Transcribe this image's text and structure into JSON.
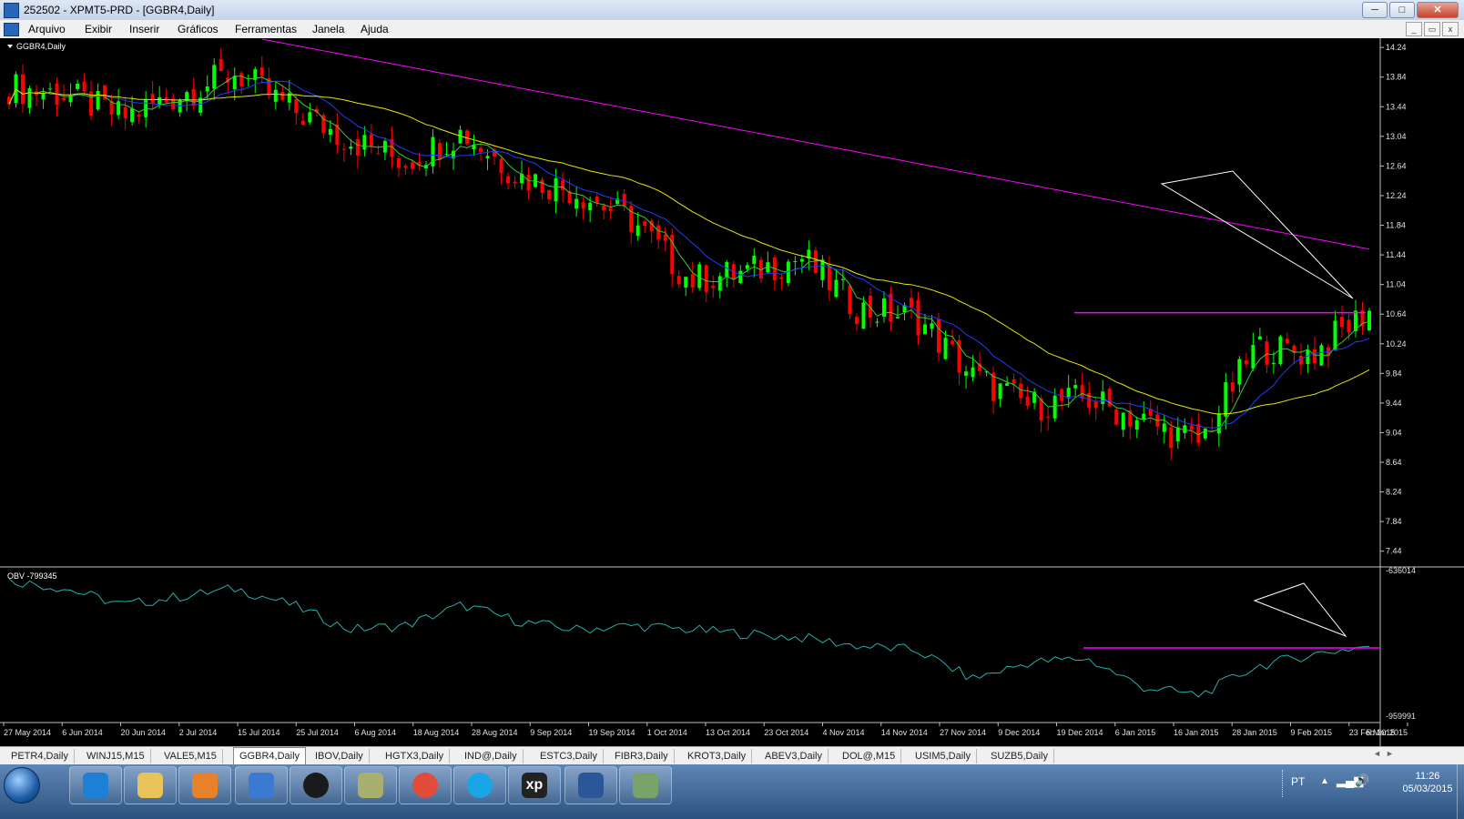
{
  "window": {
    "title": "252502 - XPMT5-PRD - [GGBR4,Daily]",
    "buttons": [
      "─",
      "□",
      "✕"
    ]
  },
  "menu": {
    "items": [
      "Arquivo",
      "Exibir",
      "Inserir",
      "Gráficos",
      "Ferramentas",
      "Janela",
      "Ajuda"
    ]
  },
  "mdi_buttons": [
    "_",
    "▭",
    "x"
  ],
  "chart": {
    "symbol_label": "GGBR4,Daily",
    "price_ticks": [
      "14.24",
      "13.84",
      "13.44",
      "13.04",
      "12.64",
      "12.24",
      "11.84",
      "11.44",
      "11.04",
      "10.64",
      "10.24",
      "9.84",
      "9.44",
      "9.04",
      "8.64",
      "8.24",
      "7.84",
      "7.44"
    ],
    "obv_label": "OBV -799345",
    "obv_ticks": [
      "-636014",
      "-959991"
    ],
    "date_labels": [
      "27 May 2014",
      "6 Jun 2014",
      "20 Jun 2014",
      "2 Jul 2014",
      "15 Jul 2014",
      "25 Jul 2014",
      "6 Aug 2014",
      "18 Aug 2014",
      "28 Aug 2014",
      "9 Sep 2014",
      "19 Sep 2014",
      "1 Oct 2014",
      "13 Oct 2014",
      "23 Oct 2014",
      "4 Nov 2014",
      "14 Nov 2014",
      "27 Nov 2014",
      "9 Dec 2014",
      "19 Dec 2014",
      "6 Jan 2015",
      "16 Jan 2015",
      "28 Jan 2015",
      "9 Feb 2015",
      "23 Feb 2015",
      "5 Mar 2015"
    ],
    "colors": {
      "bull": "#00ff00",
      "bear": "#ff0000",
      "ma_fast": "#32cd32",
      "ma_mid": "#1e3cff",
      "ma_slow": "#e6e600",
      "ma_long": "#ff00ff",
      "obv_line": "#20b2aa",
      "resistance": "#ff00ff",
      "triangle": "#ffffff"
    }
  },
  "chart_data": {
    "type": "line",
    "title": "GGBR4,Daily",
    "series": [
      {
        "name": "GGBR4,Daily",
        "x": [
          "27 May 2014",
          "6 Jun 2014",
          "20 Jun 2014",
          "2 Jul 2014",
          "15 Jul 2014",
          "25 Jul 2014",
          "6 Aug 2014",
          "18 Aug 2014",
          "28 Aug 2014",
          "9 Sep 2014",
          "19 Sep 2014",
          "1 Oct 2014",
          "13 Oct 2014",
          "23 Oct 2014",
          "4 Nov 2014",
          "14 Nov 2014",
          "27 Nov 2014",
          "9 Dec 2014",
          "19 Dec 2014",
          "6 Jan 2015",
          "16 Jan 2015",
          "28 Jan 2015",
          "9 Feb 2015",
          "23 Feb 2015",
          "5 Mar 2015"
        ],
        "values": [
          13.7,
          13.6,
          13.3,
          13.6,
          13.9,
          13.4,
          13.0,
          12.7,
          13.1,
          12.5,
          12.3,
          11.9,
          11.1,
          11.2,
          11.4,
          10.7,
          10.6,
          9.8,
          9.4,
          9.5,
          9.2,
          8.9,
          10.2,
          10.1,
          10.7
        ]
      },
      {
        "name": "OBV -799345",
        "values": [
          -640000,
          -660000,
          -700000,
          -680000,
          -660000,
          -700000,
          -760000,
          -750000,
          -700000,
          -740000,
          -760000,
          -750000,
          -760000,
          -770000,
          -780000,
          -800000,
          -810000,
          -880000,
          -840000,
          -830000,
          -900000,
          -920000,
          -850000,
          -820000,
          -799345
        ]
      }
    ],
    "ylim": [
      7.24,
      14.34
    ],
    "obv_ylim": [
      -959991,
      -636014
    ],
    "resistance_price": 10.66,
    "grid": false
  },
  "tabs": {
    "items": [
      "PETR4,Daily",
      "WINJ15,M15",
      "VALE5,M15",
      "GGBR4,Daily",
      "IBOV,Daily",
      "HGTX3,Daily",
      "IND@,Daily",
      "ESTC3,Daily",
      "FIBR3,Daily",
      "KROT3,Daily",
      "ABEV3,Daily",
      "DOL@,M15",
      "USIM5,Daily",
      "SUZB5,Daily"
    ],
    "active": 3,
    "scroll_left": "◄",
    "scroll_right": "►"
  },
  "taskbar": {
    "icons": [
      "ie-icon",
      "folder-icon",
      "media-icon",
      "arrow-app-icon",
      "hp-icon",
      "folder-app-icon",
      "chrome-icon",
      "skype-icon",
      "xp-icon",
      "word-icon",
      "chart-app-icon"
    ],
    "xp_label": "xp",
    "lang": "PT",
    "time": "11:26",
    "date": "05/03/2015"
  }
}
